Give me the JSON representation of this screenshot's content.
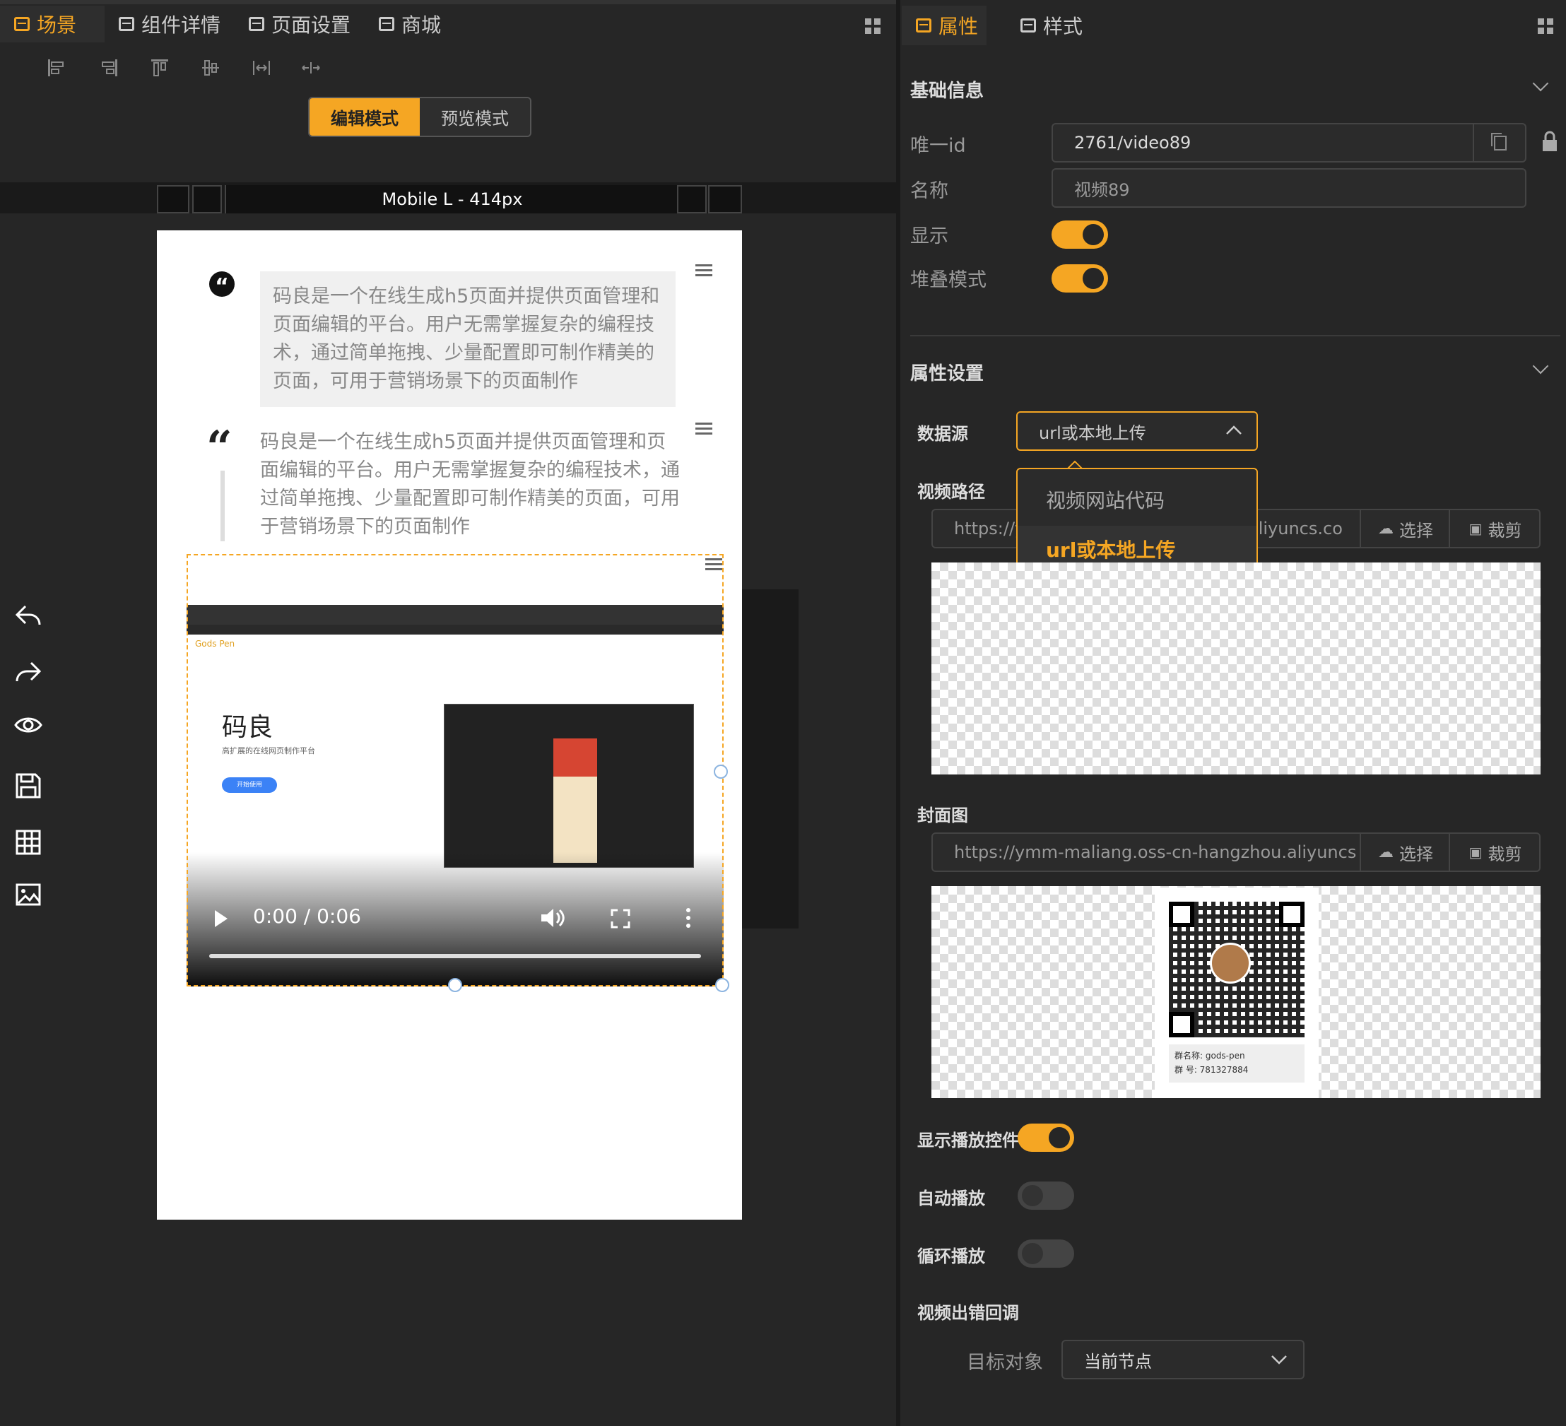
{
  "left_tabs": [
    "场景",
    "组件详情",
    "页面设置",
    "商城"
  ],
  "modes": {
    "edit": "编辑模式",
    "preview": "预览模式"
  },
  "device": "Mobile L - 414px",
  "quote1_text": "码良是一个在线生成h5页面并提供页面管理和页面编辑的平台。用户无需掌握复杂的编程技术，通过简单拖拽、少量配置即可制作精美的页面，可用于营销场景下的页面制作",
  "quote2_text": "码良是一个在线生成h5页面并提供页面管理和页面编辑的平台。用户无需掌握复杂的编程技术，通过简单拖拽、少量配置即可制作精美的页面，可用于营销场景下的页面制作",
  "video": {
    "title": "码良",
    "subtitle": "高扩展的在线网页制作平台",
    "cta": "开始使用",
    "time": "0:00 / 0:06"
  },
  "right_tabs": [
    "属性",
    "样式"
  ],
  "basic": {
    "title": "基础信息",
    "id_label": "唯一id",
    "id_value": "2761/video89",
    "name_label": "名称",
    "name_value": "视频89",
    "show_label": "显示",
    "stack_label": "堆叠模式"
  },
  "props": {
    "title": "属性设置",
    "source_label": "数据源",
    "source_value": "url或本地上传",
    "options": [
      "视频网站代码",
      "url或本地上传"
    ],
    "path_label": "视频路径",
    "path_value_left": "https://y",
    "path_value_right": "aliyuncs.co",
    "select": "选择",
    "crop": "裁剪",
    "cover_label": "封面图",
    "cover_value": "https://ymm-maliang.oss-cn-hangzhou.aliyuncs.co",
    "controls_label": "显示播放控件",
    "autoplay_label": "自动播放",
    "loop_label": "循环播放",
    "error_label": "视频出错回调",
    "target_label": "目标对象",
    "target_value": "当前节点"
  },
  "qr": {
    "group_name": "群名称:  gods-pen",
    "group_no": "群    号:  781327884"
  },
  "colors": {
    "accent": "#f5a623",
    "bg": "#262626"
  }
}
